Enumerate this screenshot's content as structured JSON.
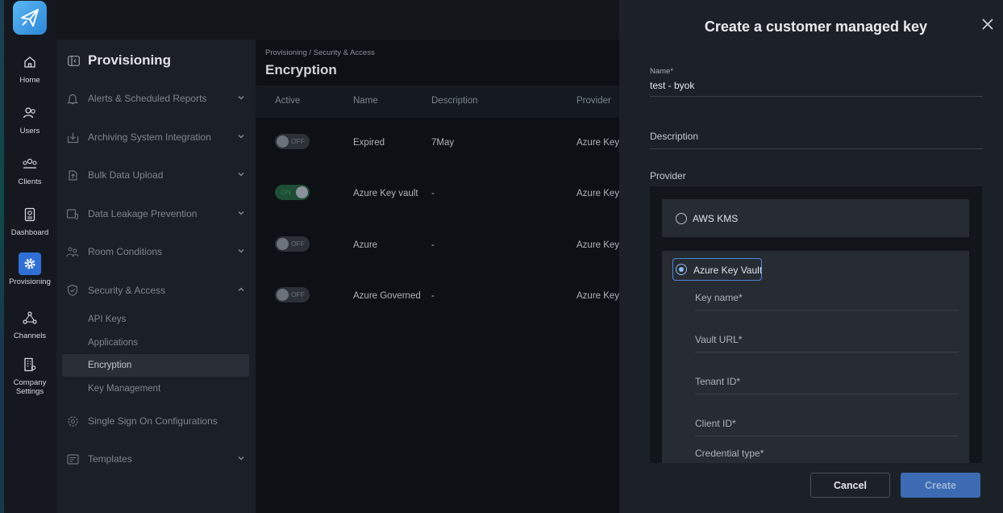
{
  "rail": {
    "items": [
      {
        "label": "Home",
        "icon": "home-icon"
      },
      {
        "label": "Users",
        "icon": "users-icon"
      },
      {
        "label": "Clients",
        "icon": "clients-icon"
      },
      {
        "label": "Dashboard",
        "icon": "dashboard-icon"
      },
      {
        "label": "Provisioning",
        "icon": "gear-icon",
        "active": true
      },
      {
        "label": "Channels",
        "icon": "channels-icon"
      },
      {
        "label": "Company Settings",
        "icon": "building-icon"
      }
    ],
    "accent": "#2f6fd6"
  },
  "nav": {
    "title": "Provisioning",
    "sections": [
      {
        "label": "Alerts & Scheduled Reports",
        "icon": "bell-icon"
      },
      {
        "label": "Archiving System Integration",
        "icon": "archive-icon"
      },
      {
        "label": "Bulk Data Upload",
        "icon": "upload-icon"
      },
      {
        "label": "Data Leakage Prevention",
        "icon": "shield-data-icon"
      },
      {
        "label": "Room Conditions",
        "icon": "room-icon"
      },
      {
        "label": "Security & Access",
        "icon": "shield-icon",
        "expanded": true
      }
    ],
    "sub_items": [
      "API Keys",
      "Applications",
      "Encryption",
      "Key Management"
    ],
    "active_sub": "Encryption",
    "sections_after": [
      {
        "label": "Single Sign On Configurations",
        "icon": "sso-icon"
      },
      {
        "label": "Templates",
        "icon": "template-icon"
      }
    ]
  },
  "main": {
    "breadcrumb": "Provisioning / Security & Access",
    "title": "Encryption",
    "columns": [
      "Active",
      "Name",
      "Description",
      "Provider"
    ],
    "rows": [
      {
        "active": "OFF",
        "name": "Expired",
        "description": "7May",
        "provider": "Azure Key"
      },
      {
        "active": "ON",
        "name": "Azure Key vault",
        "description": "-",
        "provider": "Azure Key"
      },
      {
        "active": "OFF",
        "name": "Azure",
        "description": "-",
        "provider": "Azure Key"
      },
      {
        "active": "OFF",
        "name": "Azure Governed",
        "description": "-",
        "provider": "Azure Key"
      }
    ]
  },
  "modal": {
    "title": "Create a customer managed key",
    "name_label": "Name*",
    "name_value": "test - byok",
    "description_label": "Description",
    "provider_label": "Provider",
    "provider_options": [
      "AWS KMS",
      "Azure Key Vault"
    ],
    "selected_provider": "Azure Key Vault",
    "azure_fields": [
      "Key name*",
      "Vault URL*",
      "Tenant ID*",
      "Client ID*",
      "Credential type*"
    ],
    "cancel_label": "Cancel",
    "create_label": "Create"
  }
}
